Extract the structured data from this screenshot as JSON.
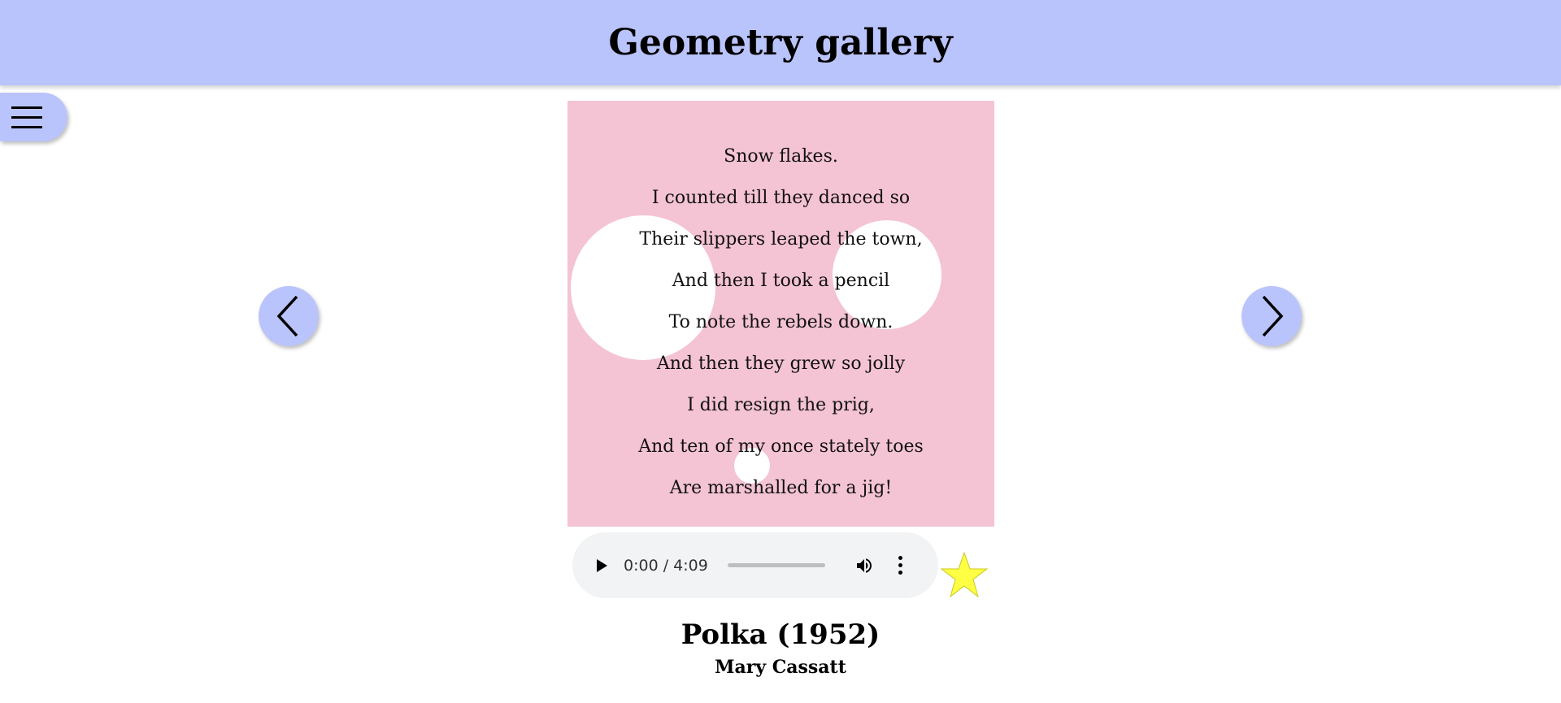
{
  "header": {
    "title": "Geometry gallery"
  },
  "menu": {
    "icon": "hamburger-menu-icon"
  },
  "navigation": {
    "prev_icon": "chevron-left-icon",
    "next_icon": "chevron-right-icon"
  },
  "artwork": {
    "background_color": "#f4c3d4",
    "circle_color": "#ffffff",
    "poem_lines": [
      "Snow flakes.",
      "I counted till they danced so",
      "Their slippers leaped the town,",
      "And then I took a pencil",
      "To note the rebels down.",
      "And then they grew so jolly",
      "I did resign the prig,",
      "And ten of my once stately toes",
      "Are marshalled for a jig!"
    ]
  },
  "audio": {
    "current_time": "0:00",
    "duration": "4:09",
    "time_display": "0:00 / 4:09",
    "progress": 0,
    "play_icon": "play-icon",
    "volume_icon": "volume-icon",
    "more_icon": "more-options-icon"
  },
  "favorite": {
    "icon": "star-icon",
    "color": "#ffff44"
  },
  "caption": {
    "title": "Polka (1952)",
    "artist": "Mary Cassatt"
  },
  "colors": {
    "accent": "#bac4fc"
  }
}
